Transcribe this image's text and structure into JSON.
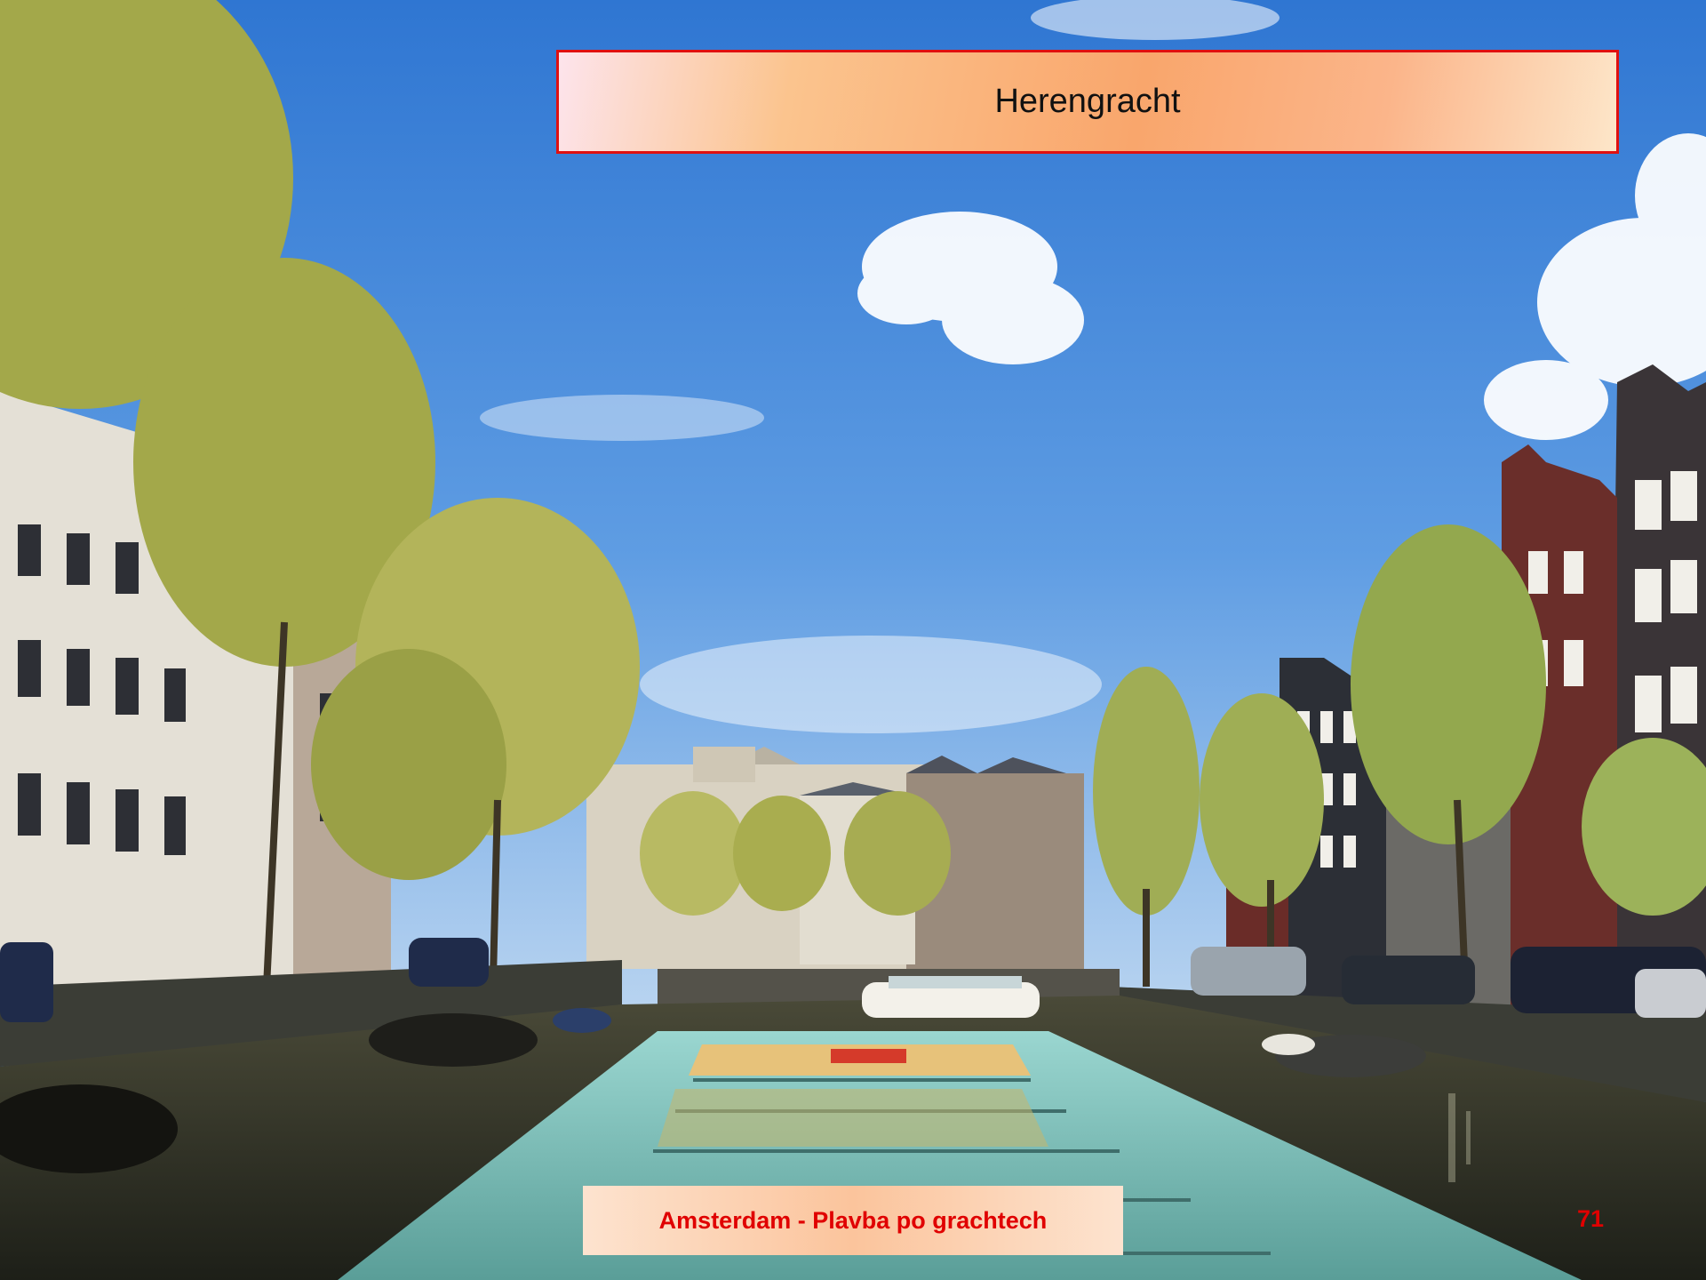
{
  "slide": {
    "title": "Herengracht",
    "footer": "Amsterdam - Plavba po grachtech",
    "page_number": "71"
  },
  "photo": {
    "colors": {
      "sky_top": "#2f76d2",
      "sky_bottom": "#a9cbef",
      "water": "#2c2d22",
      "foliage": "#a3a84a",
      "boat_roof": "#7fc6c3"
    }
  }
}
